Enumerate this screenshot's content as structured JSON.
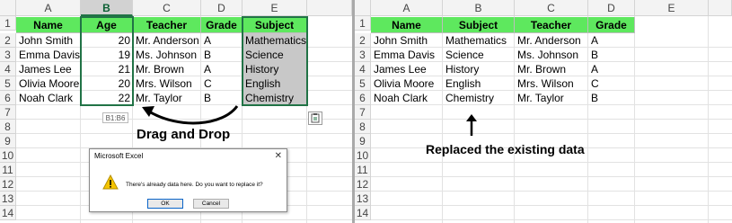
{
  "left_sheet": {
    "columns": [
      "A",
      "B",
      "C",
      "D",
      "E"
    ],
    "rows": [
      "1",
      "2",
      "3",
      "4",
      "5",
      "6",
      "7",
      "8",
      "9",
      "10",
      "11",
      "12",
      "13",
      "14"
    ],
    "headers": [
      "Name",
      "Age",
      "Teacher",
      "Grade",
      "Subject"
    ],
    "data": [
      [
        "John Smith",
        "20",
        "Mr. Anderson",
        "A",
        "Mathematics"
      ],
      [
        "Emma Davis",
        "19",
        "Ms. Johnson",
        "B",
        "Science"
      ],
      [
        "James Lee",
        "21",
        "Mr. Brown",
        "A",
        "History"
      ],
      [
        "Olivia Moore",
        "20",
        "Mrs. Wilson",
        "C",
        "English"
      ],
      [
        "Noah Clark",
        "22",
        "Mr. Taylor",
        "B",
        "Chemistry"
      ]
    ],
    "range_tooltip": "B1:B6",
    "drag_caption": "Drag and Drop"
  },
  "dialog": {
    "title": "Microsoft Excel",
    "close": "✕",
    "message": "There's already data here. Do you want to replace it?",
    "ok_label": "OK",
    "cancel_label": "Cancel"
  },
  "right_sheet": {
    "columns": [
      "A",
      "B",
      "C",
      "D",
      "E"
    ],
    "rows": [
      "1",
      "2",
      "3",
      "4",
      "5",
      "6",
      "7",
      "8",
      "9",
      "10",
      "11",
      "12",
      "13",
      "14"
    ],
    "headers": [
      "Name",
      "Subject",
      "Teacher",
      "Grade"
    ],
    "data": [
      [
        "John Smith",
        "Mathematics",
        "Mr. Anderson",
        "A"
      ],
      [
        "Emma Davis",
        "Science",
        "Ms. Johnson",
        "B"
      ],
      [
        "James Lee",
        "History",
        "Mr. Brown",
        "A"
      ],
      [
        "Olivia Moore",
        "English",
        "Mrs. Wilson",
        "C"
      ],
      [
        "Noah Clark",
        "Chemistry",
        "Mr. Taylor",
        "B"
      ]
    ],
    "result_caption": "Replaced the existing data"
  },
  "colors": {
    "header_green": "#5ee85e",
    "selection_green": "#217346",
    "shaded": "#c8c8c8"
  },
  "icons": {
    "warning": "warning-icon",
    "paste_options": "paste-options-icon",
    "arrow_curved": "curved-arrow-icon",
    "arrow_up": "up-arrow-icon"
  }
}
